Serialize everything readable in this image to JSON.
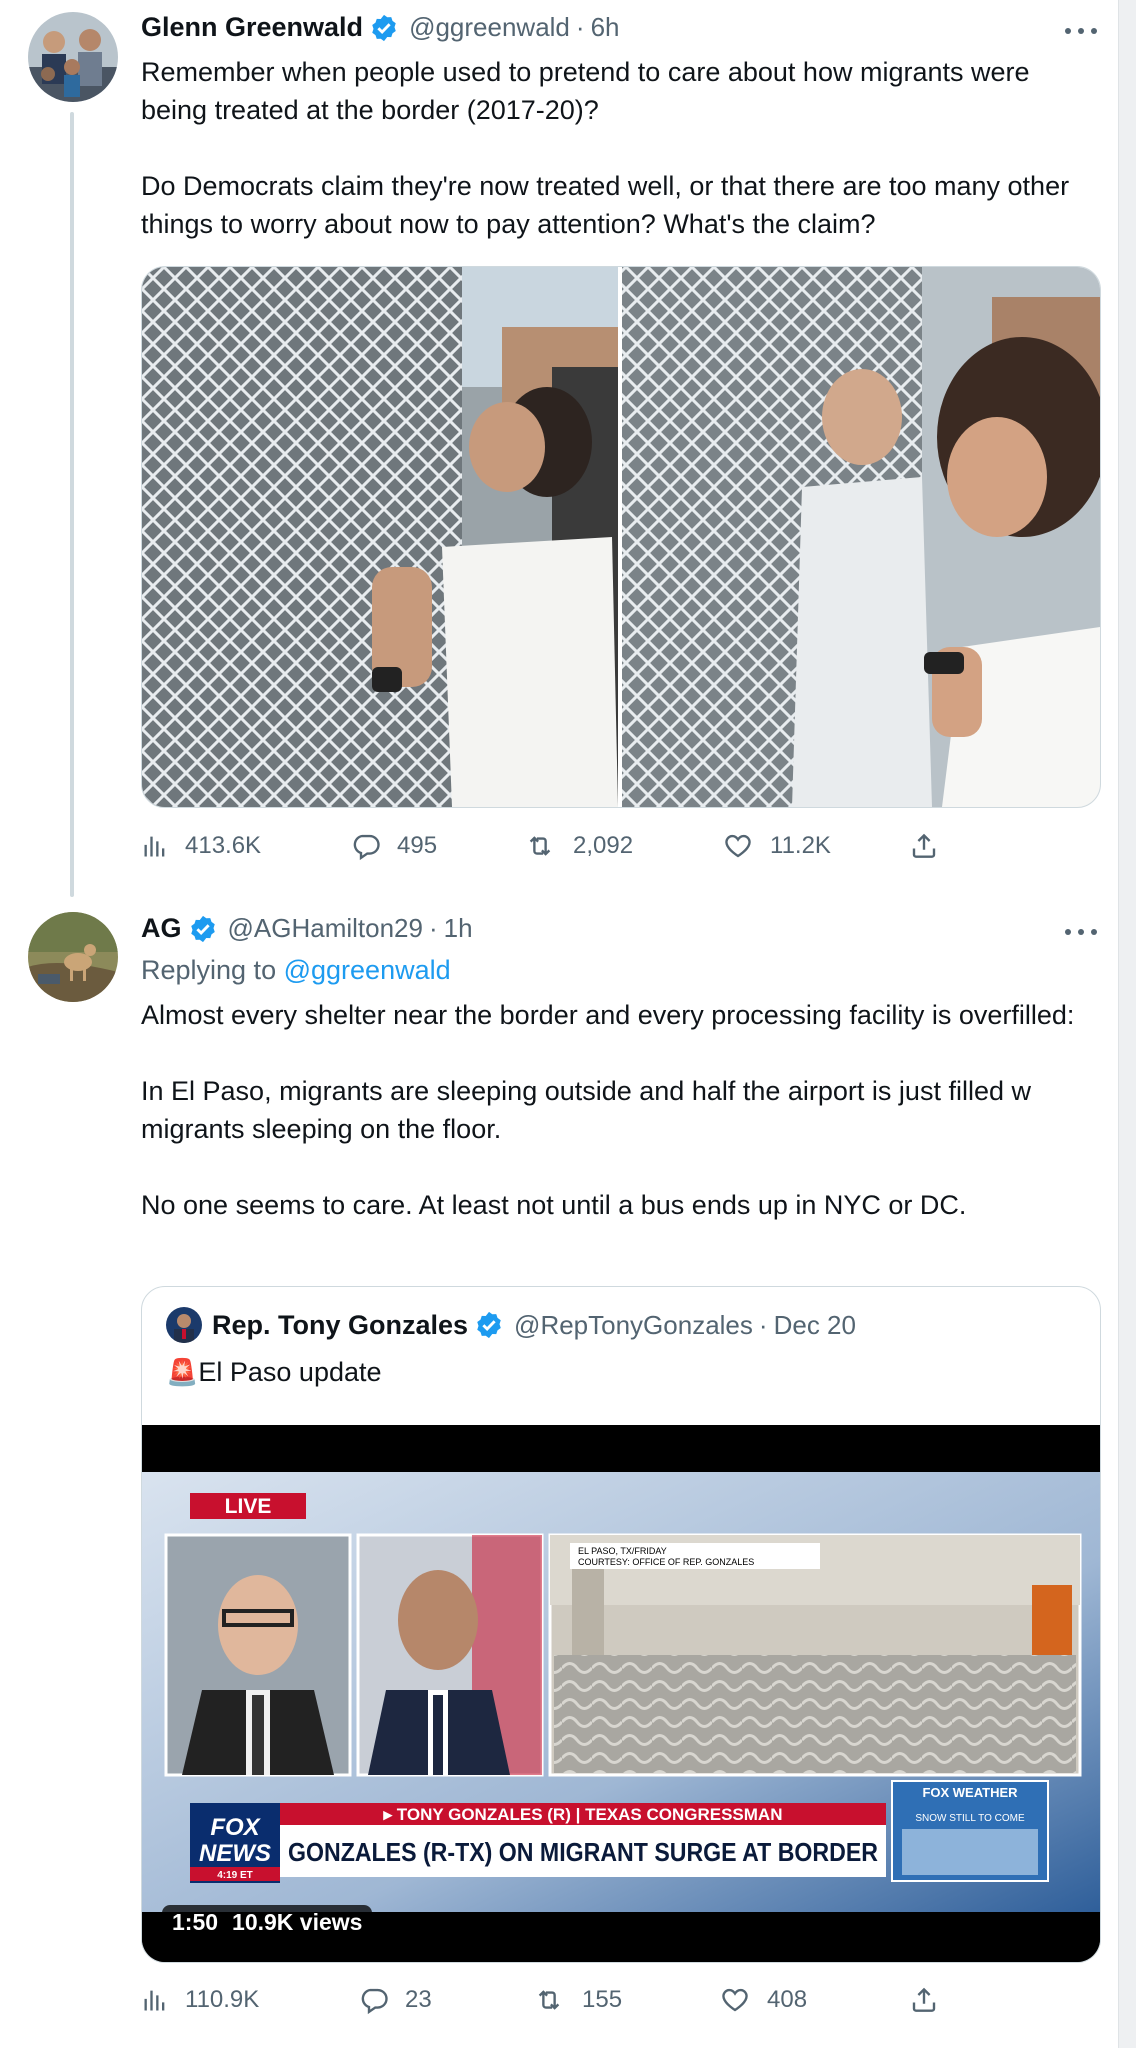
{
  "tweet1": {
    "name": "Glenn Greenwald",
    "handle": "@ggreenwald",
    "time": "6h",
    "text": "Remember when people used to pretend to care about how migrants were being treated at the border (2017-20)?\n\nDo Democrats claim they're now treated well, or that there are too many other things to worry about now to pay attention? What's the claim?",
    "stats": {
      "views": "413.6K",
      "replies": "495",
      "retweets": "2,092",
      "likes": "11.2K"
    }
  },
  "tweet2": {
    "name": "AG",
    "handle": "@AGHamilton29",
    "time": "1h",
    "replying_prefix": "Replying to",
    "replying_to": "@ggreenwald",
    "text": "Almost every shelter near the border and every processing facility is overfilled:\n\nIn El Paso, migrants are sleeping outside and half the airport is just filled w migrants sleeping on the floor.\n\nNo one seems to care. At least not until a bus ends up in NYC or DC.",
    "stats": {
      "views": "110.9K",
      "replies": "23",
      "retweets": "155",
      "likes": "408"
    }
  },
  "quote": {
    "name": "Rep. Tony Gonzales",
    "handle": "@RepTonyGonzales",
    "time": "Dec 20",
    "emoji": "🚨",
    "text": "El Paso update",
    "video": {
      "duration": "1:50",
      "views": "10.9K views",
      "live_label": "LIVE",
      "dateline": "EL PASO, TX/FRIDAY",
      "courtesy": "COURTESY: OFFICE OF REP. GONZALES",
      "lower_third_top": "▸ TONY GONZALES (R) | TEXAS CONGRESSMAN",
      "lower_third_main": "GONZALES (R-TX) ON MIGRANT SURGE AT BORDER",
      "network_line1": "FOX",
      "network_line2": "NEWS",
      "weather_title": "FOX WEATHER",
      "weather_sub": "SNOW STILL TO COME",
      "time_chip": "4:19 ET"
    }
  },
  "colors": {
    "accent": "#1d9bf0",
    "muted": "#536471",
    "border": "#cfd9de",
    "fox_red": "#c8102e",
    "fox_blue": "#0a2d6e"
  }
}
